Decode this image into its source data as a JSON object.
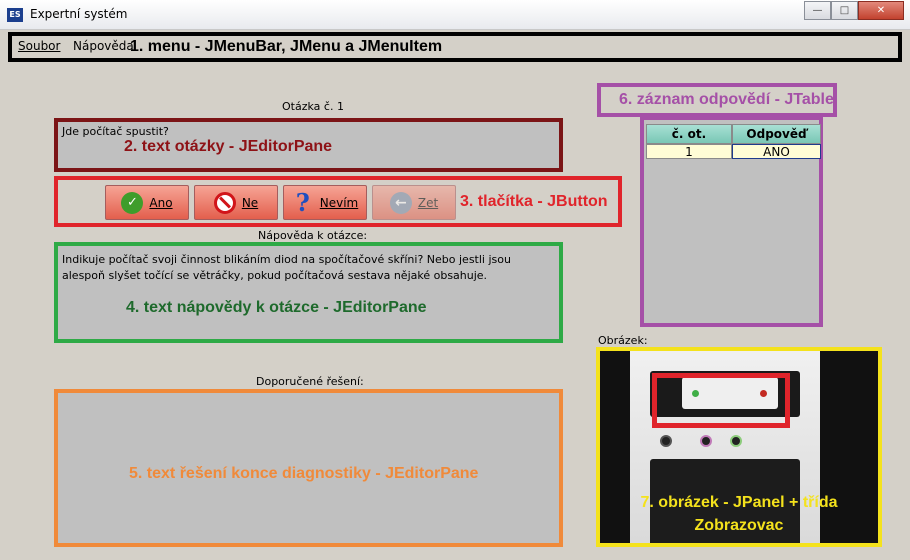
{
  "window": {
    "title": "Expertní systém",
    "icon_text": "ES"
  },
  "menubar": {
    "items": [
      {
        "label": "Soubor"
      },
      {
        "label": "Nápověda"
      }
    ],
    "annotation": "1. menu - JMenuBar, JMenu a JMenuItem"
  },
  "question": {
    "heading": "Otázka č. 1",
    "text": "Jde počítač spustit?",
    "annotation": "2. text otázky - JEditorPane"
  },
  "buttons": {
    "items": [
      {
        "label": "Ano",
        "icon": "check-icon"
      },
      {
        "label": "Ne",
        "icon": "no-entry-icon"
      },
      {
        "label": "Nevím",
        "icon": "question-mark-icon"
      },
      {
        "label": "Zet",
        "icon": "back-arrow-icon"
      }
    ],
    "annotation": "3. tlačítka - JButton"
  },
  "help": {
    "heading": "Nápověda k otázce:",
    "text": "Indikuje počítač svoji činnost blikáním diod na spočítačové skříni? Nebo jestli jsou alespoň slyšet točící se větráčky, pokud počítačová sestava nějaké obsahuje.",
    "annotation": "4. text nápovědy k otázce - JEditorPane"
  },
  "solution": {
    "heading": "Doporučené řešení:",
    "annotation": "5. text řešení konce diagnostiky - JEditorPane"
  },
  "answers": {
    "annotation": "6. záznam odpovědí - JTable",
    "columns": [
      "č. ot.",
      "Odpověď"
    ],
    "rows": [
      [
        "1",
        "ANO"
      ]
    ]
  },
  "image": {
    "heading": "Obrázek:",
    "annotation_line1": "7. obrázek - JPanel + třída",
    "annotation_line2": "Zobrazovac"
  },
  "colors": {
    "menu": "#000000",
    "question": "#7b1416",
    "buttons": "#e0242b",
    "help": "#2eaa46",
    "solution": "#f08a3a",
    "answers": "#a550a7",
    "image": "#f4e21c"
  }
}
